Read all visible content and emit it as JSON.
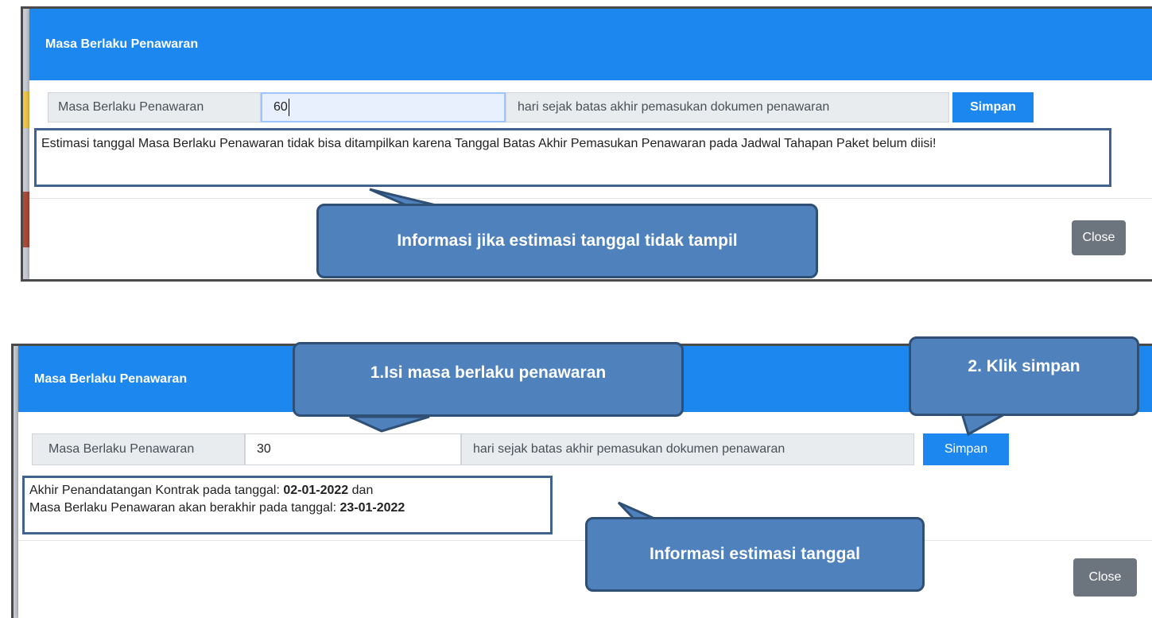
{
  "panel1": {
    "modal_title": "Masa Berlaku Penawaran",
    "field_label": "Masa Berlaku Penawaran",
    "field_value": "60",
    "field_suffix": "hari sejak batas akhir pemasukan dokumen penawaran",
    "save_label": "Simpan",
    "info_text": "Estimasi tanggal Masa Berlaku Penawaran tidak bisa ditampilkan karena Tanggal Batas Akhir Pemasukan Penawaran pada Jadwal Tahapan Paket belum diisi!",
    "close_label": "Close",
    "callout": "Informasi jika estimasi tanggal tidak tampil"
  },
  "panel2": {
    "modal_title": "Masa Berlaku Penawaran",
    "field_label": "Masa Berlaku Penawaran",
    "field_value": "30",
    "field_suffix": "hari sejak batas akhir pemasukan dokumen penawaran",
    "save_label": "Simpan",
    "info_line1_prefix": "Akhir Penandatangan Kontrak pada tanggal: ",
    "info_line1_date": "02-01-2022",
    "info_line1_suffix": " dan",
    "info_line2_prefix": "Masa Berlaku Penawaran akan berakhir pada tanggal: ",
    "info_line2_date": "23-01-2022",
    "close_label": "Close",
    "callout_fill": "1.Isi masa berlaku penawaran",
    "callout_save": "2. Klik simpan",
    "callout_info": "Informasi estimasi tanggal"
  },
  "colors": {
    "header_blue": "#1b87ef",
    "callout_fill": "#4f81bd",
    "callout_border": "#2f4f75",
    "close_gray": "#6c757d"
  }
}
